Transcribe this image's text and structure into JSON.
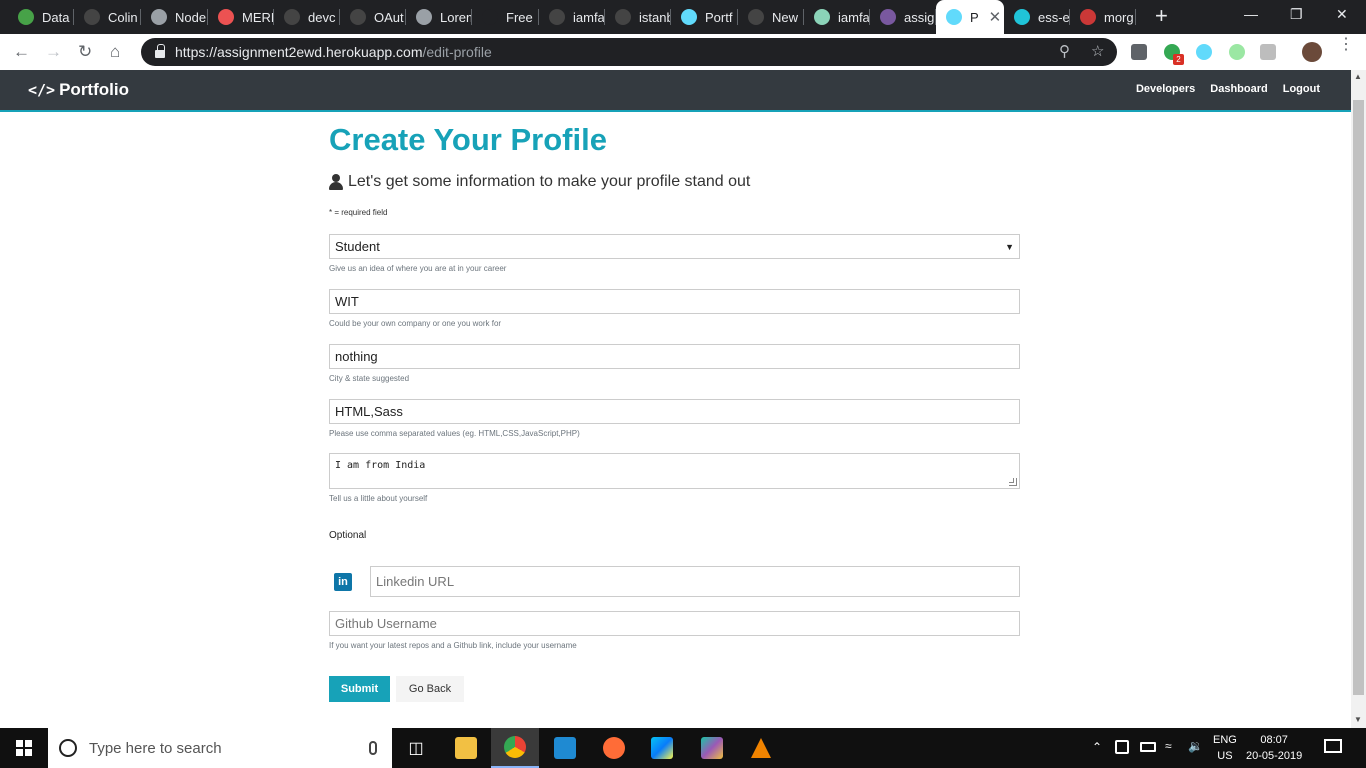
{
  "browser": {
    "tabs": [
      {
        "title": "Data",
        "icon": "mongodb-leaf-icon",
        "color": "#47a248"
      },
      {
        "title": "Colin",
        "icon": "github-icon",
        "color": "#444444"
      },
      {
        "title": "Node",
        "icon": "globe-icon",
        "color": "#9aa0a6"
      },
      {
        "title": "MERN",
        "icon": "udemy-icon",
        "color": "#ec5252"
      },
      {
        "title": "devc",
        "icon": "github-icon",
        "color": "#444444"
      },
      {
        "title": "OAut",
        "icon": "github-icon",
        "color": "#444444"
      },
      {
        "title": "Lorem",
        "icon": "lorem-icon",
        "color": "#9aa0a6"
      },
      {
        "title": "Free",
        "icon": "freecodecamp-icon",
        "color": "#202124"
      },
      {
        "title": "iamfa",
        "icon": "github-icon",
        "color": "#444444"
      },
      {
        "title": "istanb",
        "icon": "github-icon",
        "color": "#444444"
      },
      {
        "title": "Portf",
        "icon": "react-icon",
        "color": "#61dafb"
      },
      {
        "title": "New",
        "icon": "github-icon",
        "color": "#444444"
      },
      {
        "title": "iamfa",
        "icon": "gitbook-icon",
        "color": "#8bd3b8"
      },
      {
        "title": "assig",
        "icon": "heroku-icon",
        "color": "#79589f"
      },
      {
        "title": "P",
        "icon": "react-icon",
        "color": "#61dafb",
        "active": true
      },
      {
        "title": "ess-e",
        "icon": "eye-icon",
        "color": "#20c4d8"
      },
      {
        "title": "morg",
        "icon": "npm-icon",
        "color": "#cb3837"
      }
    ],
    "url_host": "https://assignment2ewd.herokuapp.com",
    "url_path": "/edit-profile",
    "extension_badge": "2"
  },
  "navbar": {
    "brand_icon": "</>",
    "brand": "Portfolio",
    "links": [
      "Developers",
      "Dashboard",
      "Logout"
    ],
    "accent": "#17a2b8"
  },
  "form": {
    "title": "Create Your Profile",
    "lead": "Let's get some information to make your profile stand out",
    "required_note": "* = required field",
    "status_value": "Student",
    "status_help": "Give us an idea of where you are at in your career",
    "company_value": "WIT",
    "company_help": "Could be your own company or one you work for",
    "location_value": "nothing",
    "location_help": "City & state suggested",
    "skills_value": "HTML,Sass",
    "skills_help": "Please use comma separated values (eg. HTML,CSS,JavaScript,PHP)",
    "bio_value": "I am from India",
    "bio_help": "Tell us a little about yourself",
    "optional_label": "Optional",
    "linkedin_icon_text": "in",
    "linkedin_placeholder": "Linkedin URL",
    "github_placeholder": "Github Username",
    "github_help": "If you want your latest repos and a Github link, include your username",
    "submit_label": "Submit",
    "back_label": "Go Back"
  },
  "taskbar": {
    "search_placeholder": "Type here to search",
    "apps": [
      "file-explorer-icon",
      "chrome-icon",
      "vscode-icon",
      "postman-icon",
      "webstorm-icon",
      "gitkraken-icon",
      "vlc-icon"
    ],
    "lang_top": "ENG",
    "lang_bottom": "US",
    "time": "08:07",
    "date": "20-05-2019"
  }
}
